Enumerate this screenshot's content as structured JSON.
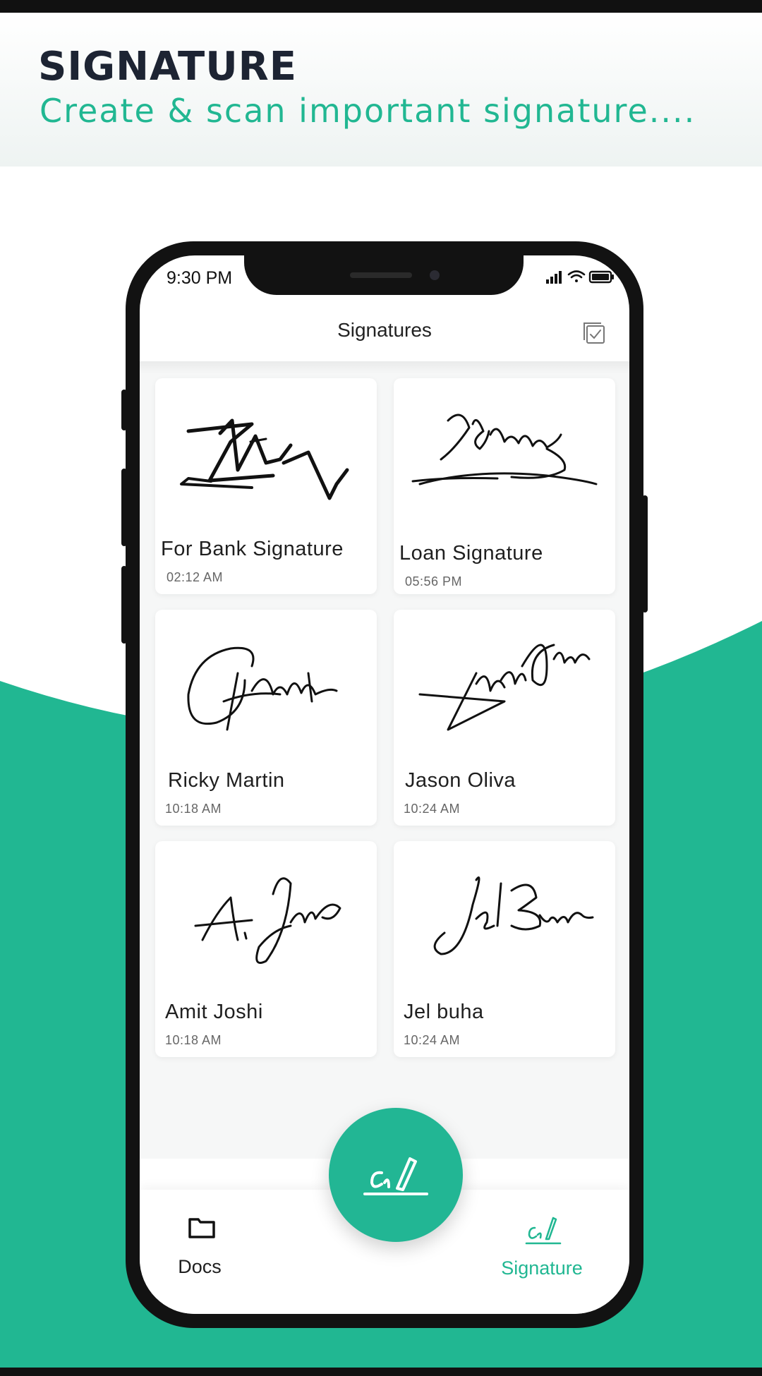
{
  "promo": {
    "title": "SIGNATURE",
    "subtitle": "Create & scan important signature...."
  },
  "colors": {
    "accent": "#21b792",
    "dark": "#1d2433"
  },
  "status_bar": {
    "time": "9:30 PM",
    "icons": [
      "signal-icon",
      "wifi-icon",
      "battery-icon"
    ]
  },
  "app_bar": {
    "title": "Signatures",
    "action_icon": "select-all-icon"
  },
  "signatures": [
    {
      "name": "For Bank Signature",
      "time": "02:12 AM"
    },
    {
      "name": "Loan Signature",
      "time": "05:56 PM"
    },
    {
      "name": "Ricky Martin",
      "time": "10:18 AM"
    },
    {
      "name": "Jason Oliva",
      "time": "10:24 AM"
    },
    {
      "name": "Amit Joshi",
      "time": "10:18 AM"
    },
    {
      "name": "Jel buha",
      "time": "10:24 AM"
    }
  ],
  "fab": {
    "icon": "signature-pen-icon"
  },
  "bottom_nav": [
    {
      "label": "Docs",
      "icon": "folder-icon",
      "active": false
    },
    {
      "label": "Signature",
      "icon": "signature-icon",
      "active": true
    }
  ]
}
